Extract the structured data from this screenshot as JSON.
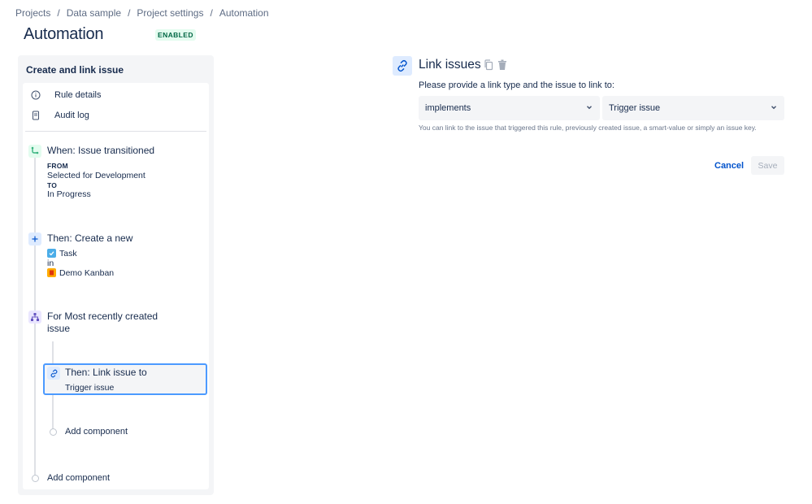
{
  "breadcrumb": {
    "items": [
      "Projects",
      "Data sample",
      "Project settings",
      "Automation"
    ],
    "separator": "/"
  },
  "page": {
    "title": "Automation",
    "status": "ENABLED"
  },
  "rule": {
    "title": "Create and link issue",
    "menu": [
      {
        "label": "Rule details",
        "icon": "info-icon"
      },
      {
        "label": "Audit log",
        "icon": "document-icon"
      }
    ],
    "trigger": {
      "title": "When: Issue transitioned",
      "from_label": "FROM",
      "from_value": "Selected for Development",
      "to_label": "TO",
      "to_value": "In Progress",
      "icon": "transition-icon"
    },
    "create_action": {
      "title": "Then: Create a new",
      "issue_type": "Task",
      "in_label": "in",
      "project": "Demo Kanban",
      "icon": "plus-icon"
    },
    "branch": {
      "title_line1": "For Most recently created",
      "title_line2": "issue",
      "icon": "branch-icon"
    },
    "link_action": {
      "title": "Then: Link issue to",
      "detail": "Trigger issue",
      "icon": "link-icon"
    },
    "add_component_inner": "Add component",
    "add_component_outer": "Add component"
  },
  "editor": {
    "title": "Link issues",
    "prompt": "Please provide a link type and the issue to link to:",
    "link_type": "implements",
    "link_target": "Trigger issue",
    "helper": "You can link to the issue that triggered this rule, previously created issue, a smart-value or simply an issue key.",
    "cancel_label": "Cancel",
    "save_label": "Save"
  },
  "colors": {
    "accent": "#0052cc",
    "selected_border": "#4c9aff",
    "enabled_bg": "#e3fcef",
    "enabled_text": "#006644",
    "trigger_green": "#36b37e",
    "branch_purple": "#6554c0"
  }
}
